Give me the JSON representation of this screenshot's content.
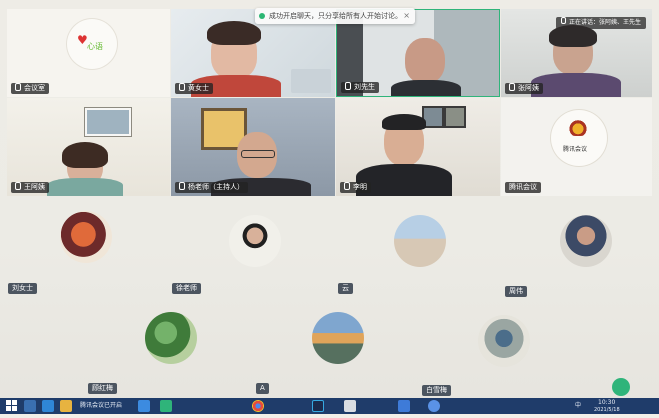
{
  "toast": {
    "message": "成功开启聊天，只分享给所有人开始讨论。",
    "close": "×"
  },
  "video_tiles": [
    {
      "id": "t1",
      "name": "会议室"
    },
    {
      "id": "t2",
      "name": "黄女士"
    },
    {
      "id": "t3",
      "name": "刘先生"
    },
    {
      "id": "t4",
      "name": "张阿姨"
    },
    {
      "id": "t5",
      "name": "王阿姨"
    },
    {
      "id": "t6",
      "name": "杨老师（主持人）"
    },
    {
      "id": "t7",
      "name": "李明"
    },
    {
      "id": "t8",
      "name": "腾讯会议"
    }
  ],
  "speaker_banner": "正在讲话：张阿姨、王先生",
  "tile8_logo_text": "腾讯会议",
  "tile1_logo_text": "心语",
  "avatars_row1": [
    {
      "name": "刘女士"
    },
    {
      "name": "徐老师"
    },
    {
      "name": "云"
    },
    {
      "name": "周伟"
    }
  ],
  "avatars_row2": [
    {
      "name": "顾红梅"
    },
    {
      "name": "A"
    },
    {
      "name": "白雪梅"
    }
  ],
  "taskbar": {
    "app_label": "腾讯会议已开启",
    "time": "10:30",
    "date": "2021/5/18",
    "lang": "中"
  },
  "colors": {
    "accent": "#2fb47a",
    "taskbar": "#1f3c6a",
    "name_tag": "#333333"
  }
}
